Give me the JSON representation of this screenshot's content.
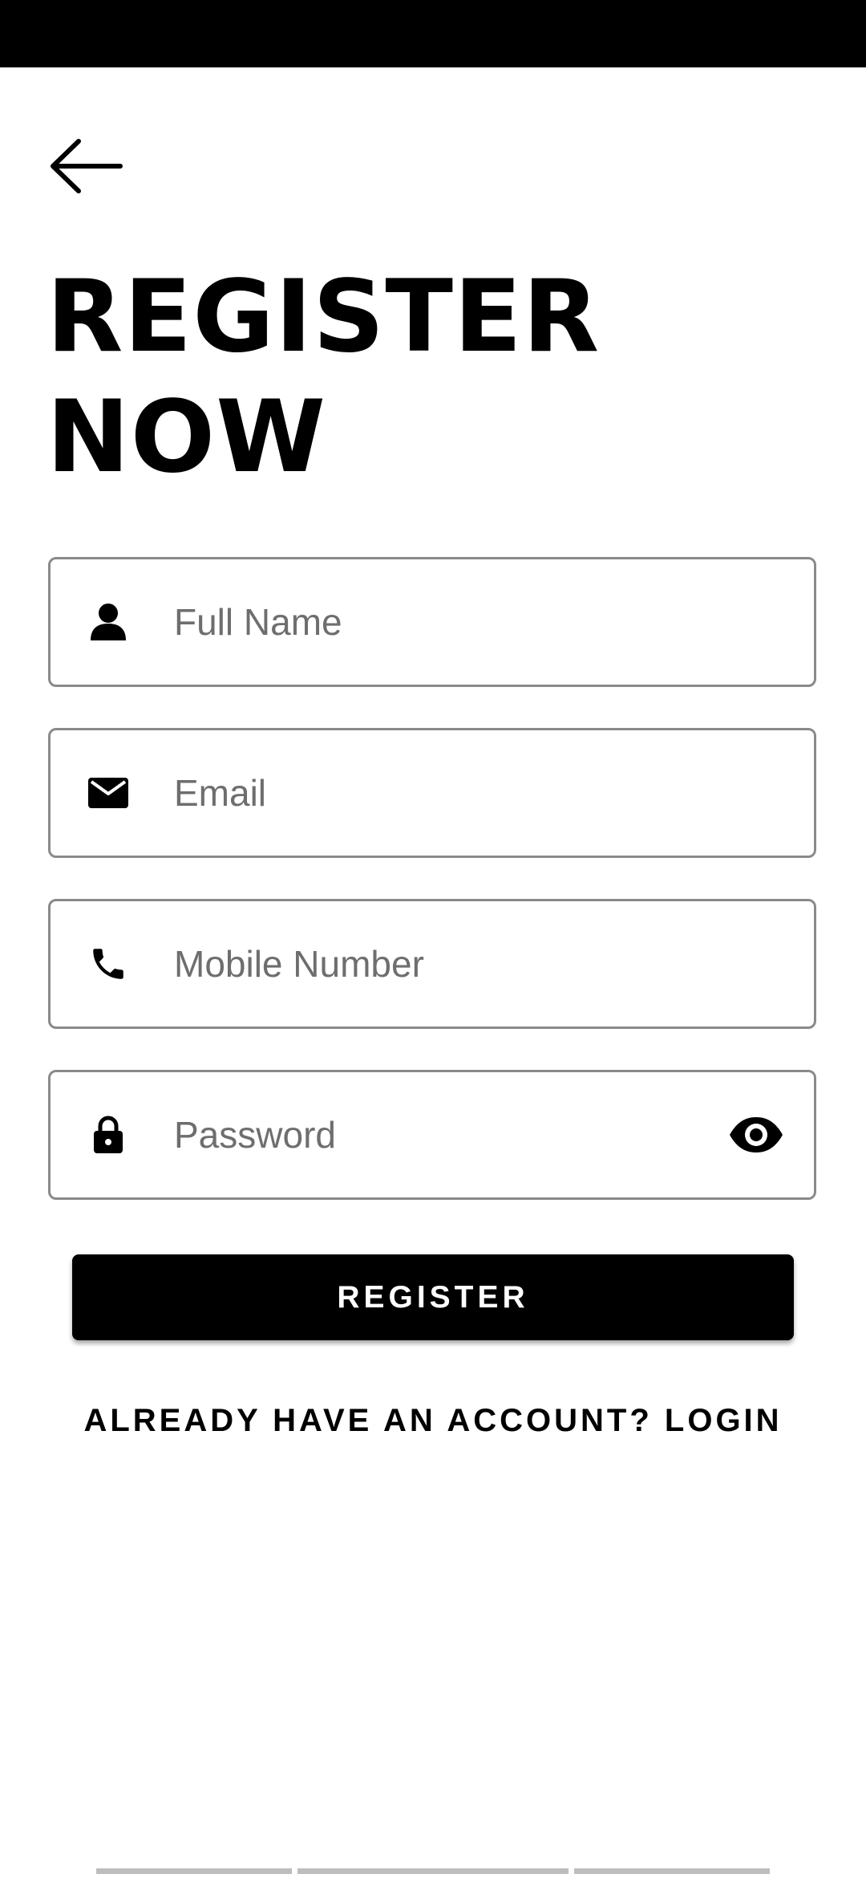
{
  "header": {
    "back_icon": "arrow-left-icon"
  },
  "title": {
    "line1": "REGISTER",
    "line2": "NOW"
  },
  "form": {
    "full_name": {
      "icon": "person-icon",
      "placeholder": "Full Name",
      "value": ""
    },
    "email": {
      "icon": "envelope-icon",
      "placeholder": "Email",
      "value": ""
    },
    "mobile": {
      "icon": "phone-icon",
      "placeholder": "Mobile Number",
      "value": ""
    },
    "password": {
      "icon": "lock-icon",
      "placeholder": "Password",
      "value": "",
      "toggle_icon": "eye-icon"
    }
  },
  "actions": {
    "register_label": "REGISTER",
    "login_link_label": "ALREADY HAVE AN ACCOUNT? LOGIN"
  },
  "colors": {
    "primary": "#000000",
    "background": "#ffffff",
    "field_border": "#8a8a8a",
    "placeholder": "#6e6e6e"
  }
}
